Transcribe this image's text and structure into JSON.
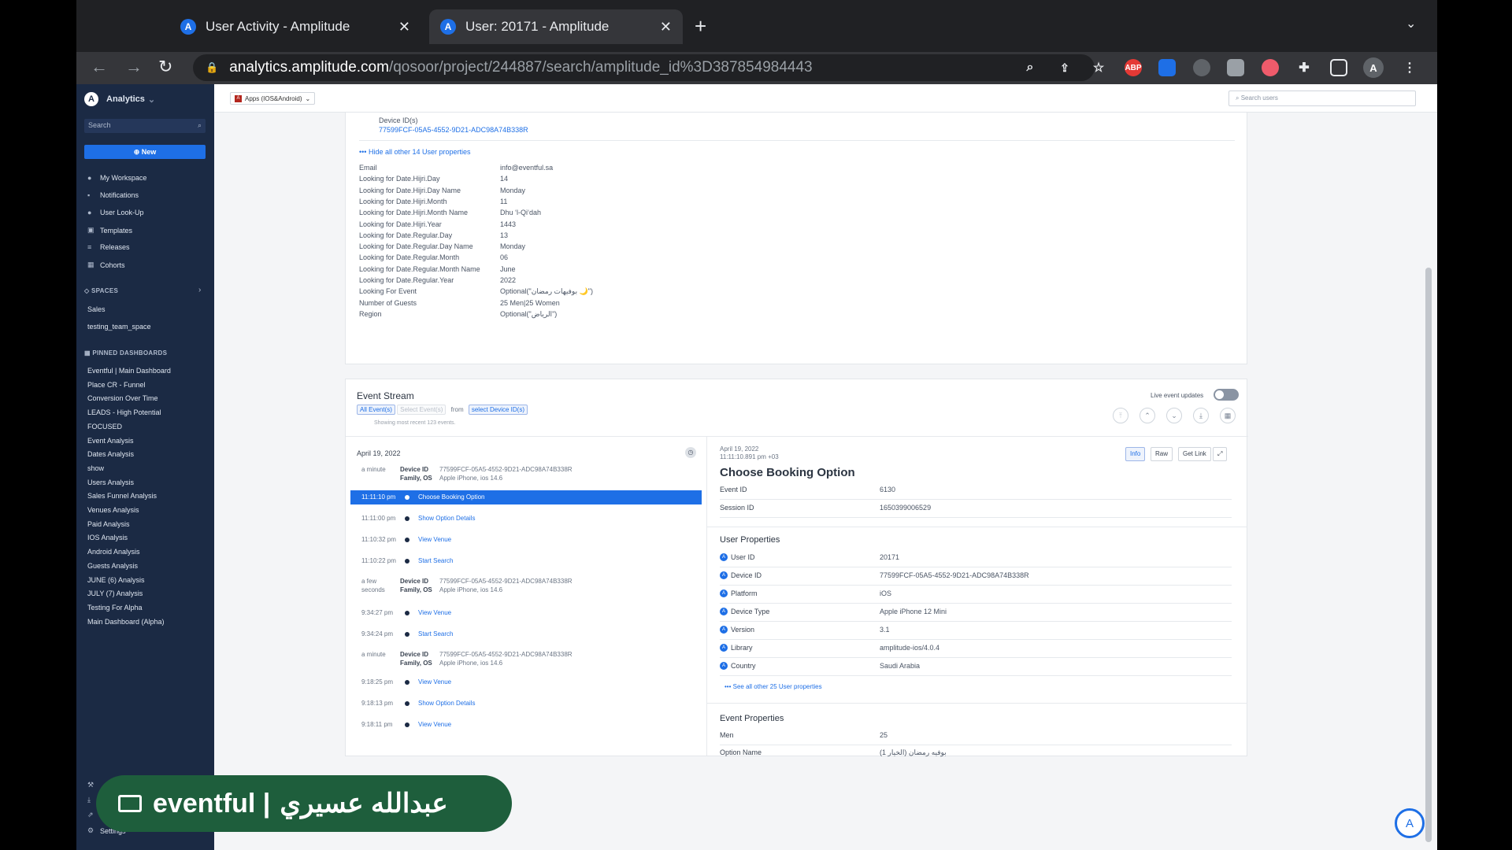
{
  "browser": {
    "tabs": [
      {
        "title": "User Activity - Amplitude"
      },
      {
        "title": "User: 20171 - Amplitude"
      }
    ],
    "url_host": "analytics.amplitude.com",
    "url_path": "/qosoor/project/244887/search/amplitude_id%3D387854984443",
    "ext_abp": "ABP",
    "profile_initial": "A"
  },
  "sidebar": {
    "app_name": "Analytics",
    "search_placeholder": "Search",
    "new_label": "New",
    "nav": [
      {
        "label": "My Workspace"
      },
      {
        "label": "Notifications"
      },
      {
        "label": "User Look-Up"
      },
      {
        "label": "Templates"
      },
      {
        "label": "Releases"
      },
      {
        "label": "Cohorts"
      }
    ],
    "spaces_title": "SPACES",
    "spaces": [
      "Sales",
      "testing_team_space"
    ],
    "pinned_title": "PINNED DASHBOARDS",
    "pinned": [
      "Eventful | Main Dashboard",
      "Place CR - Funnel",
      "Conversion Over Time",
      "LEADS - High Potential",
      "FOCUSED",
      "Event Analysis",
      "Dates Analysis",
      "show",
      "Users Analysis",
      "Sales Funnel Analysis",
      "Venues Analysis",
      "Paid Analysis",
      "IOS Analysis",
      "Android Analysis",
      "Guests Analysis",
      "JUNE (6) Analysis",
      "JULY (7) Analysis",
      "Testing For Alpha",
      "Main Dashboard (Alpha)"
    ],
    "settings_label": "Settings"
  },
  "header": {
    "app_selector": "Apps (IOS&Android)",
    "search_users_placeholder": "Search users"
  },
  "user_props": {
    "device_ids_label": "Device ID(s)",
    "device_id": "77599FCF-05A5-4552-9D21-ADC98A74B338R",
    "hide_link": "••• Hide all other 14 User properties",
    "rows": [
      {
        "k": "Email",
        "v": "info@eventful.sa"
      },
      {
        "k": "Looking for Date.Hijri.Day",
        "v": "14"
      },
      {
        "k": "Looking for Date.Hijri.Day Name",
        "v": "Monday"
      },
      {
        "k": "Looking for Date.Hijri.Month",
        "v": "11"
      },
      {
        "k": "Looking for Date.Hijri.Month Name",
        "v": "Dhu ʻl-Qiʻdah"
      },
      {
        "k": "Looking for Date.Hijri.Year",
        "v": "1443"
      },
      {
        "k": "Looking for Date.Regular.Day",
        "v": "13"
      },
      {
        "k": "Looking for Date.Regular.Day Name",
        "v": "Monday"
      },
      {
        "k": "Looking for Date.Regular.Month",
        "v": "06"
      },
      {
        "k": "Looking for Date.Regular.Month Name",
        "v": "June"
      },
      {
        "k": "Looking for Date.Regular.Year",
        "v": "2022"
      },
      {
        "k": "Looking For Event",
        "v": "Optional(\"بوفيهات رمضان 🌙\")"
      },
      {
        "k": "Number of Guests",
        "v": "25 Men|25 Women"
      },
      {
        "k": "Region",
        "v": "Optional(\"الرياض\")"
      }
    ]
  },
  "event_stream": {
    "title": "Event Stream",
    "live_label": "Live event updates",
    "filter_all": "All Event(s)",
    "filter_select": "Select Event(s)",
    "from": "from",
    "filter_device": "select Device ID(s)",
    "showing": "Showing most recent 123 events.",
    "date": "April 19, 2022",
    "device_label": "Device ID",
    "family_label": "Family, OS",
    "device_value": "77599FCF-05A5-4552-9D21-ADC98A74B338R",
    "family_value": "Apple iPhone, ios 14.6",
    "groups": [
      {
        "ago": "a minute",
        "events": [
          {
            "t": "11:11:10 pm",
            "n": "Choose Booking Option"
          },
          {
            "t": "11:11:00 pm",
            "n": "Show Option Details"
          },
          {
            "t": "11:10:32 pm",
            "n": "View Venue"
          },
          {
            "t": "11:10:22 pm",
            "n": "Start Search"
          }
        ]
      },
      {
        "ago": "a few seconds",
        "events": [
          {
            "t": "9:34:27 pm",
            "n": "View Venue"
          },
          {
            "t": "9:34:24 pm",
            "n": "Start Search"
          }
        ]
      },
      {
        "ago": "a minute",
        "events": [
          {
            "t": "9:18:25 pm",
            "n": "View Venue"
          },
          {
            "t": "9:18:13 pm",
            "n": "Show Option Details"
          },
          {
            "t": "9:18:11 pm",
            "n": "View Venue"
          }
        ]
      }
    ]
  },
  "detail": {
    "date": "April 19, 2022",
    "time": "11:11:10.891 pm +03",
    "tab_info": "Info",
    "tab_raw": "Raw",
    "get_link": "Get Link",
    "title": "Choose Booking Option",
    "event_id_label": "Event ID",
    "event_id": "6130",
    "session_id_label": "Session ID",
    "session_id": "1650399006529",
    "user_props_title": "User Properties",
    "user_props": [
      {
        "k": "User ID",
        "v": "20171"
      },
      {
        "k": "Device ID",
        "v": "77599FCF-05A5-4552-9D21-ADC98A74B338R"
      },
      {
        "k": "Platform",
        "v": "iOS"
      },
      {
        "k": "Device Type",
        "v": "Apple iPhone 12 Mini"
      },
      {
        "k": "Version",
        "v": "3.1"
      },
      {
        "k": "Library",
        "v": "amplitude-ios/4.0.4"
      },
      {
        "k": "Country",
        "v": "Saudi Arabia"
      }
    ],
    "see_all": "••• See all other 25 User properties",
    "event_props_title": "Event Properties",
    "event_props": [
      {
        "k": "Men",
        "v": "25"
      },
      {
        "k": "Option Name",
        "v": "بوفيه رمضان (الخيار 1)"
      }
    ]
  },
  "overlay": {
    "brand": "eventful |",
    "name": "عبدالله عسيري"
  }
}
